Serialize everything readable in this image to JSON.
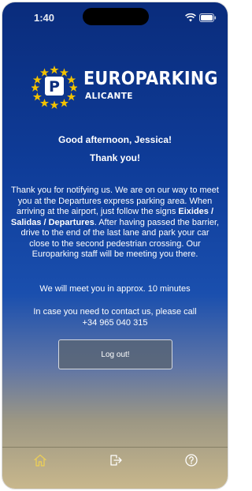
{
  "status_bar": {
    "time": "1:40"
  },
  "brand": {
    "name": "EUROPARKING",
    "location": "ALICANTE",
    "logo_letter": "P"
  },
  "greeting": {
    "salutation": "Good afternoon, Jessica!",
    "thanks": "Thank you!"
  },
  "message": {
    "part1": "Thank you for notifying us. We are on our way to meet you at the Departures express parking area. When arriving at the airport, just follow the signs ",
    "signs": "Eixides / Salidas / Departures",
    "part2": ". After having passed the barrier, drive to the end of the last lane and park your car close to the second pedestrian crossing. Our Europarking staff will be meeting you there.",
    "eta": "We will meet you in approx. 10 minutes",
    "contact_prompt": "In case you need to contact us, please call",
    "phone": "+34 965 040 315"
  },
  "actions": {
    "logout_label": "Log out!"
  },
  "tabbar": {
    "items": [
      {
        "icon": "home-icon"
      },
      {
        "icon": "exit-icon"
      },
      {
        "icon": "help-icon"
      }
    ]
  },
  "colors": {
    "brand_blue": "#0a2c7c",
    "star_gold": "#f2c200",
    "tab_icon_active": "#e8cc5a",
    "tab_icon": "#ffffff"
  }
}
